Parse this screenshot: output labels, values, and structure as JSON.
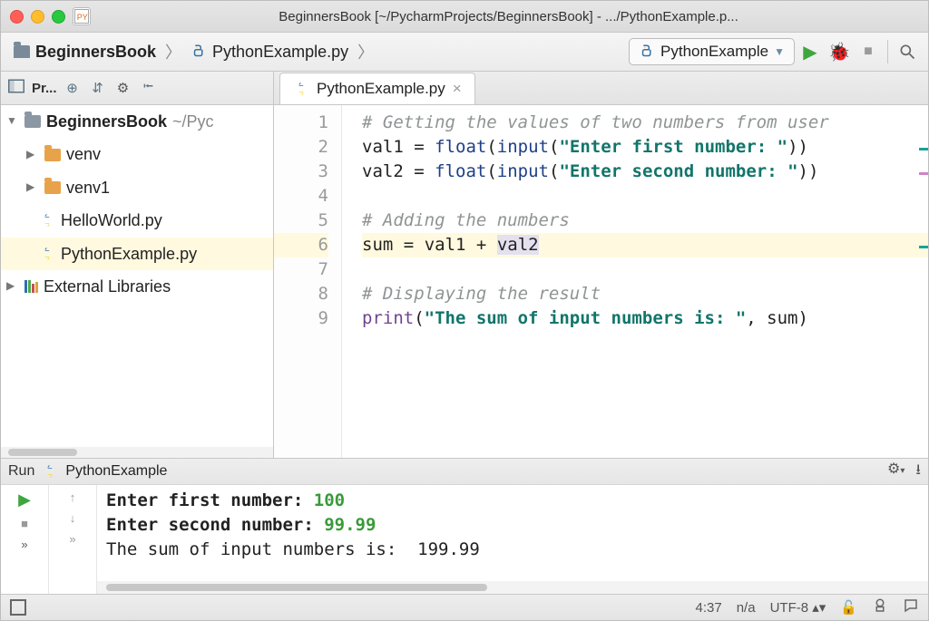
{
  "titlebar": {
    "title": "BeginnersBook [~/PycharmProjects/BeginnersBook] - .../PythonExample.p..."
  },
  "breadcrumb": {
    "project": "BeginnersBook",
    "file": "PythonExample.py"
  },
  "runconfig": {
    "selected": "PythonExample"
  },
  "sidebar": {
    "title": "Pr...",
    "root": {
      "name": "BeginnersBook",
      "path": "~/Pyc"
    },
    "items": [
      {
        "name": "venv"
      },
      {
        "name": "venv1"
      },
      {
        "name": "HelloWorld.py"
      },
      {
        "name": "PythonExample.py"
      }
    ],
    "external": "External Libraries"
  },
  "tab": {
    "name": "PythonExample.py"
  },
  "code": {
    "lines": [
      {
        "n": "1",
        "type": "comment",
        "text": "# Getting the values of two numbers from user"
      },
      {
        "n": "2",
        "type": "asg1",
        "var": "val1",
        "func": "float",
        "inner": "input",
        "str": "\"Enter first number: \""
      },
      {
        "n": "3",
        "type": "asg1",
        "var": "val2",
        "func": "float",
        "inner": "input",
        "str": "\"Enter second number: \"",
        "hl": "hl1"
      },
      {
        "n": "4",
        "type": "blank"
      },
      {
        "n": "5",
        "type": "comment",
        "text": "# Adding the numbers"
      },
      {
        "n": "6",
        "type": "sum",
        "lhs": "sum",
        "a": "val1",
        "b": "val2",
        "row_hl": true
      },
      {
        "n": "7",
        "type": "blank"
      },
      {
        "n": "8",
        "type": "comment",
        "text": "# Displaying the result"
      },
      {
        "n": "9",
        "type": "print",
        "fn": "print",
        "str": "\"The sum of input numbers is: \"",
        "arg": "sum"
      }
    ]
  },
  "run": {
    "header": "Run",
    "name": "PythonExample",
    "output": [
      {
        "prompt": "Enter first number: ",
        "input": "100"
      },
      {
        "prompt": "Enter second number: ",
        "input": "99.99"
      },
      {
        "text": "The sum of input numbers is:  199.99"
      }
    ]
  },
  "status": {
    "pos": "4:37",
    "sep": "n/a",
    "enc": "UTF-8"
  }
}
